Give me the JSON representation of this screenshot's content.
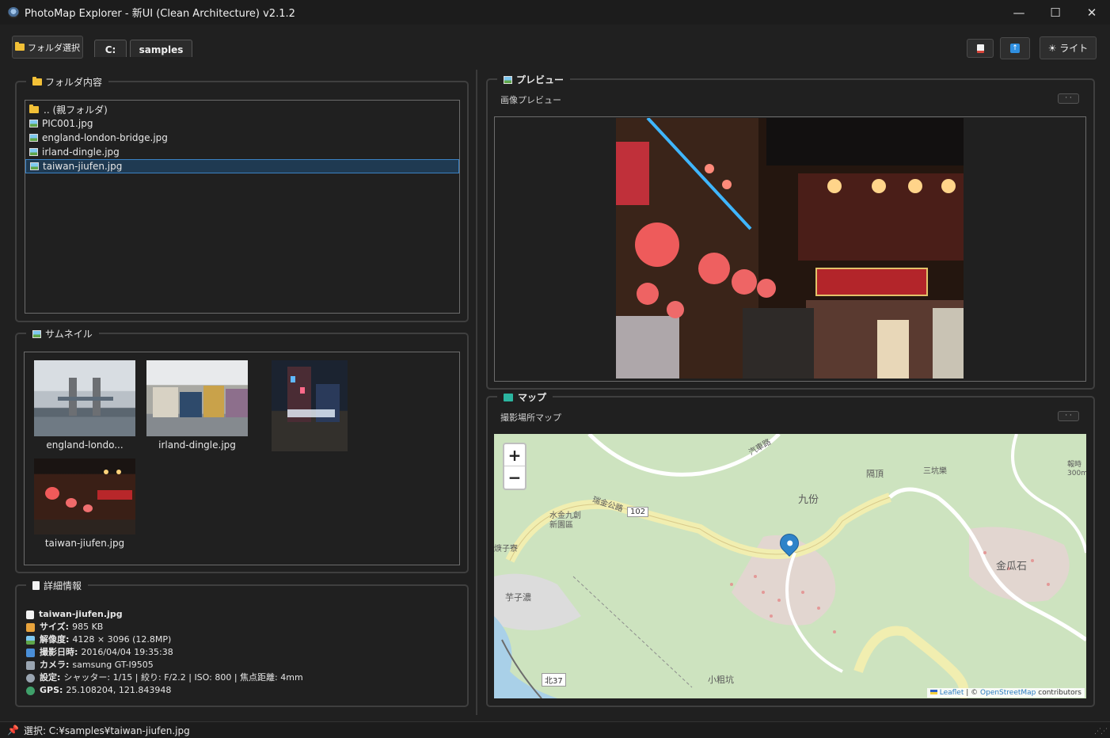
{
  "window": {
    "title": "PhotoMap Explorer - 新UI (Clean Architecture) v2.1.2",
    "minimize": "—",
    "maximize": "☐",
    "close": "✕"
  },
  "toolbar": {
    "folder_select_label": "フォルダ選択",
    "path_segments": [
      "C:",
      "samples"
    ],
    "theme_label": "☀ ライト",
    "icons": [
      "pdf-icon",
      "upload-icon",
      "sun-icon"
    ]
  },
  "folder_panel": {
    "title": "フォルダ内容",
    "items": [
      {
        "label": ".. (親フォルダ)",
        "icon": "folder-icon",
        "selected": false
      },
      {
        "label": "PIC001.jpg",
        "icon": "image-icon",
        "selected": false
      },
      {
        "label": "england-london-bridge.jpg",
        "icon": "image-icon",
        "selected": false
      },
      {
        "label": "irland-dingle.jpg",
        "icon": "image-icon",
        "selected": false
      },
      {
        "label": "taiwan-jiufen.jpg",
        "icon": "image-icon",
        "selected": true
      }
    ]
  },
  "thumbnail_panel": {
    "title": "サムネイル",
    "items": [
      {
        "caption": "england-londo..."
      },
      {
        "caption": "irland-dingle.jpg"
      },
      {
        "caption": ""
      },
      {
        "caption": "taiwan-jiufen.jpg"
      }
    ]
  },
  "details_panel": {
    "title": "詳細情報",
    "filename": "taiwan-jiufen.jpg",
    "rows": [
      {
        "label": "サイズ:",
        "value": "985 KB",
        "icon": "package-icon",
        "color": "#e8a33c"
      },
      {
        "label": "解像度:",
        "value": "4128 × 3096 (12.8MP)",
        "icon": "image-icon",
        "color": "#6ab04c"
      },
      {
        "label": "撮影日時:",
        "value": "2016/04/04 19:35:38",
        "icon": "calendar-icon",
        "color": "#4a8fd8"
      },
      {
        "label": "カメラ:",
        "value": "samsung GT-I9505",
        "icon": "camera-icon",
        "color": "#9aa5b1"
      },
      {
        "label": "設定:",
        "value": "シャッター: 1/15 | 絞り: F/2.2 | ISO: 800 | 焦点距離: 4mm",
        "icon": "gear-icon",
        "color": "#9aa5b1"
      },
      {
        "label": "GPS:",
        "value": "25.108204, 121.843948",
        "icon": "globe-icon",
        "color": "#3fa06a"
      }
    ]
  },
  "preview_panel": {
    "title": "プレビュー",
    "subtitle": "画像プレビュー",
    "dots": "· ·"
  },
  "map_panel": {
    "title": "マップ",
    "subtitle": "撮影場所マップ",
    "dots": "· ·",
    "zoom_in": "+",
    "zoom_out": "−",
    "attribution_leaflet": "Leaflet",
    "attribution_sep": " | © ",
    "attribution_osm": "OpenStreetMap",
    "attribution_tail": " contributors",
    "labels": [
      "九份",
      "隔頂",
      "金瓜石",
      "水金九創\n新園區",
      "芋子濃",
      "小粗坑",
      "瑞金公路",
      "102",
      "北37",
      "焿子寮",
      "報時\n300m",
      "三坑樂",
      "汽車路"
    ]
  },
  "statusbar": {
    "text": "選択: C:¥samples¥taiwan-jiufen.jpg"
  }
}
